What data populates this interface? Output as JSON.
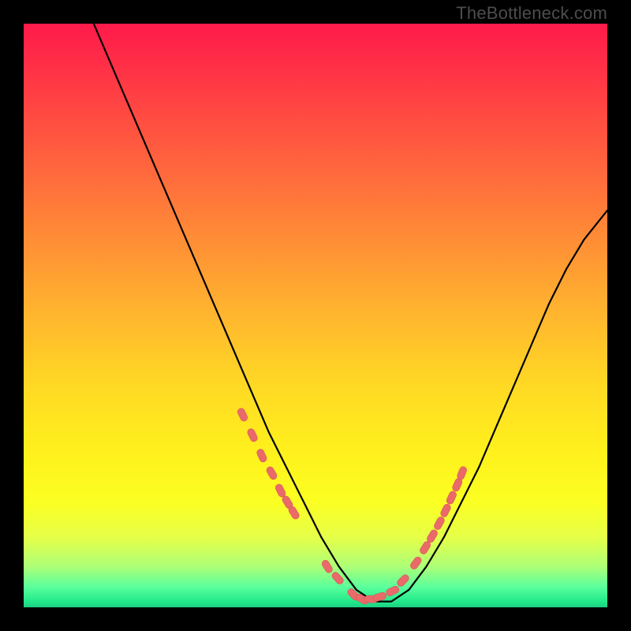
{
  "watermark": "TheBottleneck.com",
  "colors": {
    "frame": "#000000",
    "curve": "#000000",
    "marker_fill": "#ea6a6a",
    "marker_stroke": "#d75657"
  },
  "chart_data": {
    "type": "line",
    "title": "",
    "xlabel": "",
    "ylabel": "",
    "xlim": [
      0,
      100
    ],
    "ylim": [
      0,
      100
    ],
    "grid": false,
    "legend": false,
    "note": "Bottleneck-style V curve. y≈100 means worst (top of gradient, red), y≈0 means best (bottom, green). Minimum around x≈58.",
    "series": [
      {
        "name": "bottleneck_curve",
        "x": [
          12,
          15,
          18,
          21,
          24,
          27,
          30,
          33,
          36,
          39,
          42,
          45,
          48,
          51,
          54,
          57,
          60,
          63,
          66,
          69,
          72,
          75,
          78,
          81,
          84,
          87,
          90,
          93,
          96,
          100
        ],
        "y": [
          100,
          93,
          86,
          79,
          72,
          65,
          58,
          51,
          44,
          37,
          30,
          24,
          18,
          12,
          7,
          3,
          1,
          1,
          3,
          7,
          12,
          18,
          24,
          31,
          38,
          45,
          52,
          58,
          63,
          68
        ]
      }
    ],
    "markers": {
      "name": "highlight_points",
      "x": [
        37.5,
        39.2,
        40.8,
        42.5,
        44.0,
        45.2,
        46.3,
        52.0,
        53.8,
        56.5,
        58.0,
        59.5,
        61.0,
        63.2,
        65.0,
        67.2,
        68.8,
        70.0,
        71.2,
        72.3,
        73.3,
        74.3,
        75.1
      ],
      "y": [
        33.0,
        29.5,
        26.0,
        23.0,
        20.0,
        18.0,
        16.2,
        7.0,
        5.0,
        2.2,
        1.4,
        1.4,
        1.8,
        2.8,
        4.6,
        7.6,
        10.2,
        12.2,
        14.4,
        16.6,
        18.8,
        21.0,
        23.0
      ]
    }
  }
}
